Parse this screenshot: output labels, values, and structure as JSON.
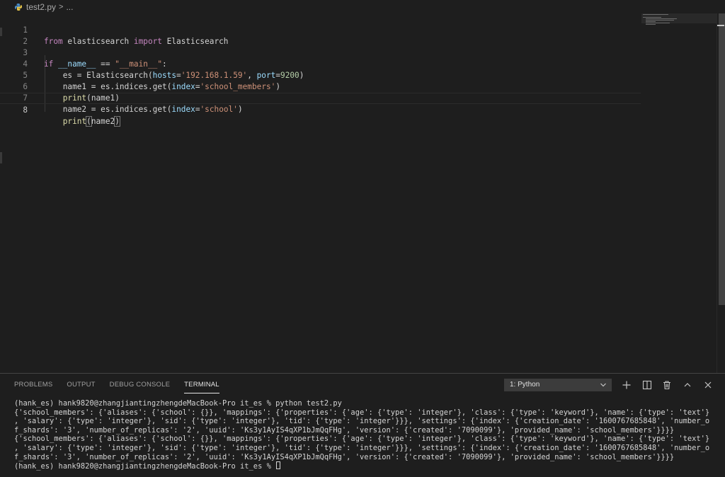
{
  "breadcrumb": {
    "file": "test2.py",
    "separator": ">",
    "more": "..."
  },
  "editor": {
    "lines": [
      {
        "number": "1"
      },
      {
        "number": "2"
      },
      {
        "number": "3"
      },
      {
        "number": "4"
      },
      {
        "number": "5"
      },
      {
        "number": "6"
      },
      {
        "number": "7"
      },
      {
        "number": "8"
      }
    ],
    "tokens": {
      "l1_from": "from",
      "l1_mod": " elasticsearch ",
      "l1_import": "import",
      "l1_cls": " Elasticsearch",
      "l3_if": "if",
      "l3_name": " __name__",
      "l3_eq": " == ",
      "l3_main": "\"__main__\"",
      "l3_colon": ":",
      "l4_es": "    es",
      "l4_eq": " = ",
      "l4_cls": "Elasticsearch",
      "l4_open": "(",
      "l4_hosts": "hosts",
      "l4_eq2": "=",
      "l4_ip": "'192.168.1.59'",
      "l4_comma": ", ",
      "l4_port": "port",
      "l4_eq3": "=",
      "l4_num": "9200",
      "l4_close": ")",
      "l5_name": "    name1",
      "l5_eq": " = ",
      "l5_es": "es",
      "l5_dot1": ".",
      "l5_indices": "indices",
      "l5_dot2": ".",
      "l5_get": "get",
      "l5_open": "(",
      "l5_index": "index",
      "l5_eq2": "=",
      "l5_str": "'school_members'",
      "l5_close": ")",
      "l6_indent": "    ",
      "l6_print": "print",
      "l6_open": "(",
      "l6_arg": "name1",
      "l6_close": ")",
      "l7_name": "    name2",
      "l7_eq": " = ",
      "l7_es": "es",
      "l7_dot1": ".",
      "l7_indices": "indices",
      "l7_dot2": ".",
      "l7_get": "get",
      "l7_open": "(",
      "l7_index": "index",
      "l7_eq2": "=",
      "l7_str": "'school'",
      "l7_close": ")",
      "l8_indent": "    ",
      "l8_print": "print",
      "l8_open": "(",
      "l8_arg": "name2",
      "l8_close": ")"
    }
  },
  "panel": {
    "tabs": [
      "PROBLEMS",
      "OUTPUT",
      "DEBUG CONSOLE",
      "TERMINAL"
    ],
    "active_tab": "TERMINAL",
    "terminal_selector": "1: Python",
    "actions": [
      "plus-icon",
      "split-icon",
      "trash-icon",
      "chevron-up-icon",
      "close-icon"
    ],
    "terminal_lines": [
      "(hank_es) hank9820@zhangjiantingzhengdeMacBook-Pro it_es % python test2.py",
      "{'school_members': {'aliases': {'school': {}}, 'mappings': {'properties': {'age': {'type': 'integer'}, 'class': {'type': 'keyword'}, 'name': {'type': 'text'}",
      ", 'salary': {'type': 'integer'}, 'sid': {'type': 'integer'}, 'tid': {'type': 'integer'}}}, 'settings': {'index': {'creation_date': '1600767685848', 'number_o",
      "f_shards': '3', 'number_of_replicas': '2', 'uuid': 'Ks3y1AyIS4qXP1bJmQqFHg', 'version': {'created': '7090099'}, 'provided_name': 'school_members'}}}}",
      "{'school_members': {'aliases': {'school': {}}, 'mappings': {'properties': {'age': {'type': 'integer'}, 'class': {'type': 'keyword'}, 'name': {'type': 'text'}",
      ", 'salary': {'type': 'integer'}, 'sid': {'type': 'integer'}, 'tid': {'type': 'integer'}}}, 'settings': {'index': {'creation_date': '1600767685848', 'number_o",
      "f_shards': '3', 'number_of_replicas': '2', 'uuid': 'Ks3y1AyIS4qXP1bJmQqFHg', 'version': {'created': '7090099'}, 'provided_name': 'school_members'}}}}",
      "(hank_es) hank9820@zhangjiantingzhengdeMacBook-Pro it_es % "
    ]
  },
  "colors": {
    "background": "#1e1e1e",
    "keyword": "#c586c0",
    "string": "#ce9178",
    "function": "#dcdcaa",
    "class": "#4ec9b0",
    "variable": "#9cdcfe",
    "number": "#b5cea8"
  }
}
